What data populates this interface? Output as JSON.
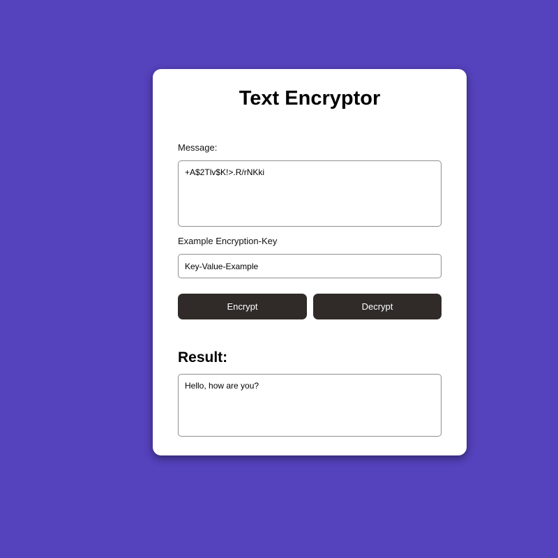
{
  "app": {
    "title": "Text Encryptor"
  },
  "form": {
    "message_label": "Message:",
    "message_value": "+A$2Tlv$K!>.R/rNKki",
    "key_label": "Example Encryption-Key",
    "key_value": "Key-Value-Example"
  },
  "actions": {
    "encrypt_label": "Encrypt",
    "decrypt_label": "Decrypt"
  },
  "result": {
    "heading": "Result:",
    "value": "Hello, how are you?"
  },
  "colors": {
    "background": "#5542bd",
    "card": "#ffffff",
    "button": "#302b28",
    "button_text": "#ffffff"
  }
}
